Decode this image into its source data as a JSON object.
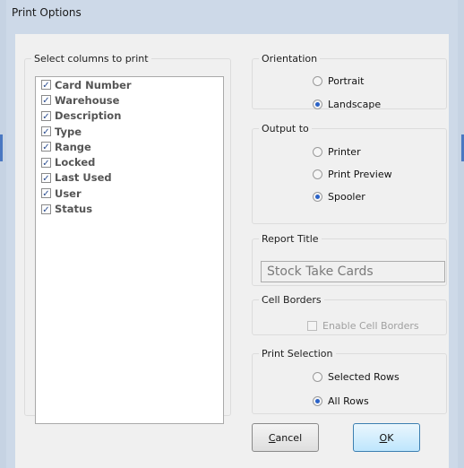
{
  "window": {
    "title": "Print Options"
  },
  "columns_group": {
    "legend": "Select columns to print",
    "items": [
      {
        "label": "Card Number",
        "checked": true
      },
      {
        "label": "Warehouse",
        "checked": true
      },
      {
        "label": "Description",
        "checked": true
      },
      {
        "label": "Type",
        "checked": true
      },
      {
        "label": "Range",
        "checked": true
      },
      {
        "label": "Locked",
        "checked": true
      },
      {
        "label": "Last Used",
        "checked": true
      },
      {
        "label": "User",
        "checked": true
      },
      {
        "label": "Status",
        "checked": true
      }
    ]
  },
  "orientation": {
    "legend": "Orientation",
    "options": [
      {
        "label": "Portrait",
        "selected": false
      },
      {
        "label": "Landscape",
        "selected": true
      }
    ]
  },
  "output": {
    "legend": "Output to",
    "options": [
      {
        "label": "Printer",
        "selected": false
      },
      {
        "label": "Print Preview",
        "selected": false
      },
      {
        "label": "Spooler",
        "selected": true
      }
    ]
  },
  "report_title": {
    "legend": "Report Title",
    "value": "Stock Take Cards"
  },
  "cell_borders": {
    "legend": "Cell Borders",
    "checkbox_label": "Enable Cell Borders",
    "checked": false
  },
  "print_selection": {
    "legend": "Print Selection",
    "options": [
      {
        "label": "Selected Rows",
        "selected": false
      },
      {
        "label": "All Rows",
        "selected": true
      }
    ]
  },
  "buttons": {
    "cancel_mnemonic": "C",
    "cancel_rest": "ancel",
    "ok_mnemonic": "O",
    "ok_rest": "K"
  },
  "colors": {
    "accent": "#2a62c7",
    "dialog_frame": "#cdd9e8",
    "client_bg": "#f0f0f0"
  }
}
